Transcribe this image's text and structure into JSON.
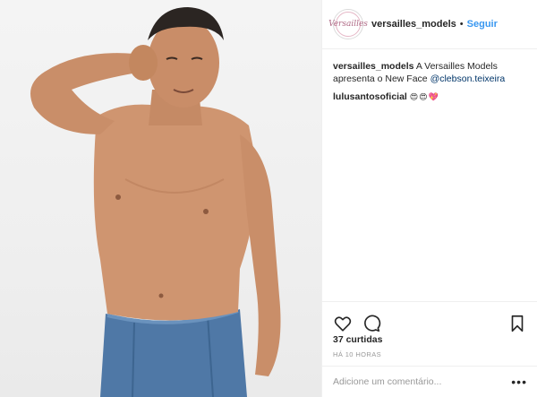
{
  "post": {
    "author": "versailles_models",
    "avatar_text": "Versailles",
    "separator": "•",
    "follow_label": "Seguir",
    "caption": {
      "username": "versailles_models",
      "text": " A Versailles Models apresenta o New Face ",
      "mention": "@clebson.teixeira"
    },
    "comments": [
      {
        "username": "lulusantosoficial",
        "text": "😍😍💖"
      }
    ],
    "likes": "37 curtidas",
    "timestamp": "HÁ 10 HORAS",
    "comment_placeholder": "Adicione um comentário...",
    "more_label": "•••"
  },
  "icons": {
    "like": "heart-icon",
    "comment": "comment-icon",
    "save": "bookmark-icon",
    "more": "more-options-icon"
  },
  "colors": {
    "accent": "#3897f0",
    "text": "#262626",
    "muted": "#999999",
    "border": "#efefef"
  }
}
